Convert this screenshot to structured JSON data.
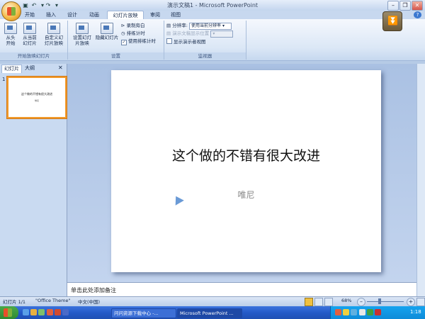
{
  "window": {
    "title": "演示文稿1 - Microsoft PowerPoint",
    "minimize": "–",
    "maximize": "❐",
    "close": "✕"
  },
  "quick_access": {
    "save": "▣",
    "undo": "↶",
    "redo": "↷",
    "more": "▾"
  },
  "tabs": [
    "开始",
    "插入",
    "设计",
    "动画",
    "幻灯片放映",
    "审阅",
    "视图"
  ],
  "active_tab": "幻灯片放映",
  "ribbon": {
    "groups": {
      "start_show": "开始放映幻灯片",
      "setup": "设置",
      "monitors": "监视器"
    },
    "buttons": {
      "from_beginning": [
        "从头",
        "开始"
      ],
      "from_current": [
        "从当前",
        "幻灯片"
      ],
      "custom_show": [
        "自定义幻",
        "灯片放映"
      ],
      "setup_show": [
        "设置幻灯",
        "片放映"
      ],
      "hide_slide": "隐藏幻灯片",
      "record_narration": "录制旁白",
      "rehearse_timings": "排练计时",
      "use_timings": "使用排练计时"
    },
    "monitors": {
      "resolution_label": "分辨率:",
      "resolution_value": "使用当前分辨率",
      "show_on_label": "演示文稿显示位置",
      "presenter_view": "显示演示者视图"
    }
  },
  "left_pane": {
    "tabs": [
      "幻灯片",
      "大纲"
    ],
    "close": "✕",
    "slide_number": "1",
    "thumb_title": "这个做的不错有很大改进",
    "thumb_subtitle": "唯尼"
  },
  "slide": {
    "title": "这个做的不错有很大改进",
    "subtitle": "唯尼"
  },
  "notes": {
    "placeholder": "单击此处添加备注"
  },
  "status": {
    "slide_count": "幻灯片 1/1",
    "theme": "\"Office Theme\"",
    "language": "中文(中国)",
    "zoom": "68%"
  },
  "taskbar": {
    "items": [
      "问问资源下载中心 -...",
      "Microsoft PowerPoint ..."
    ],
    "time": "1:18"
  }
}
